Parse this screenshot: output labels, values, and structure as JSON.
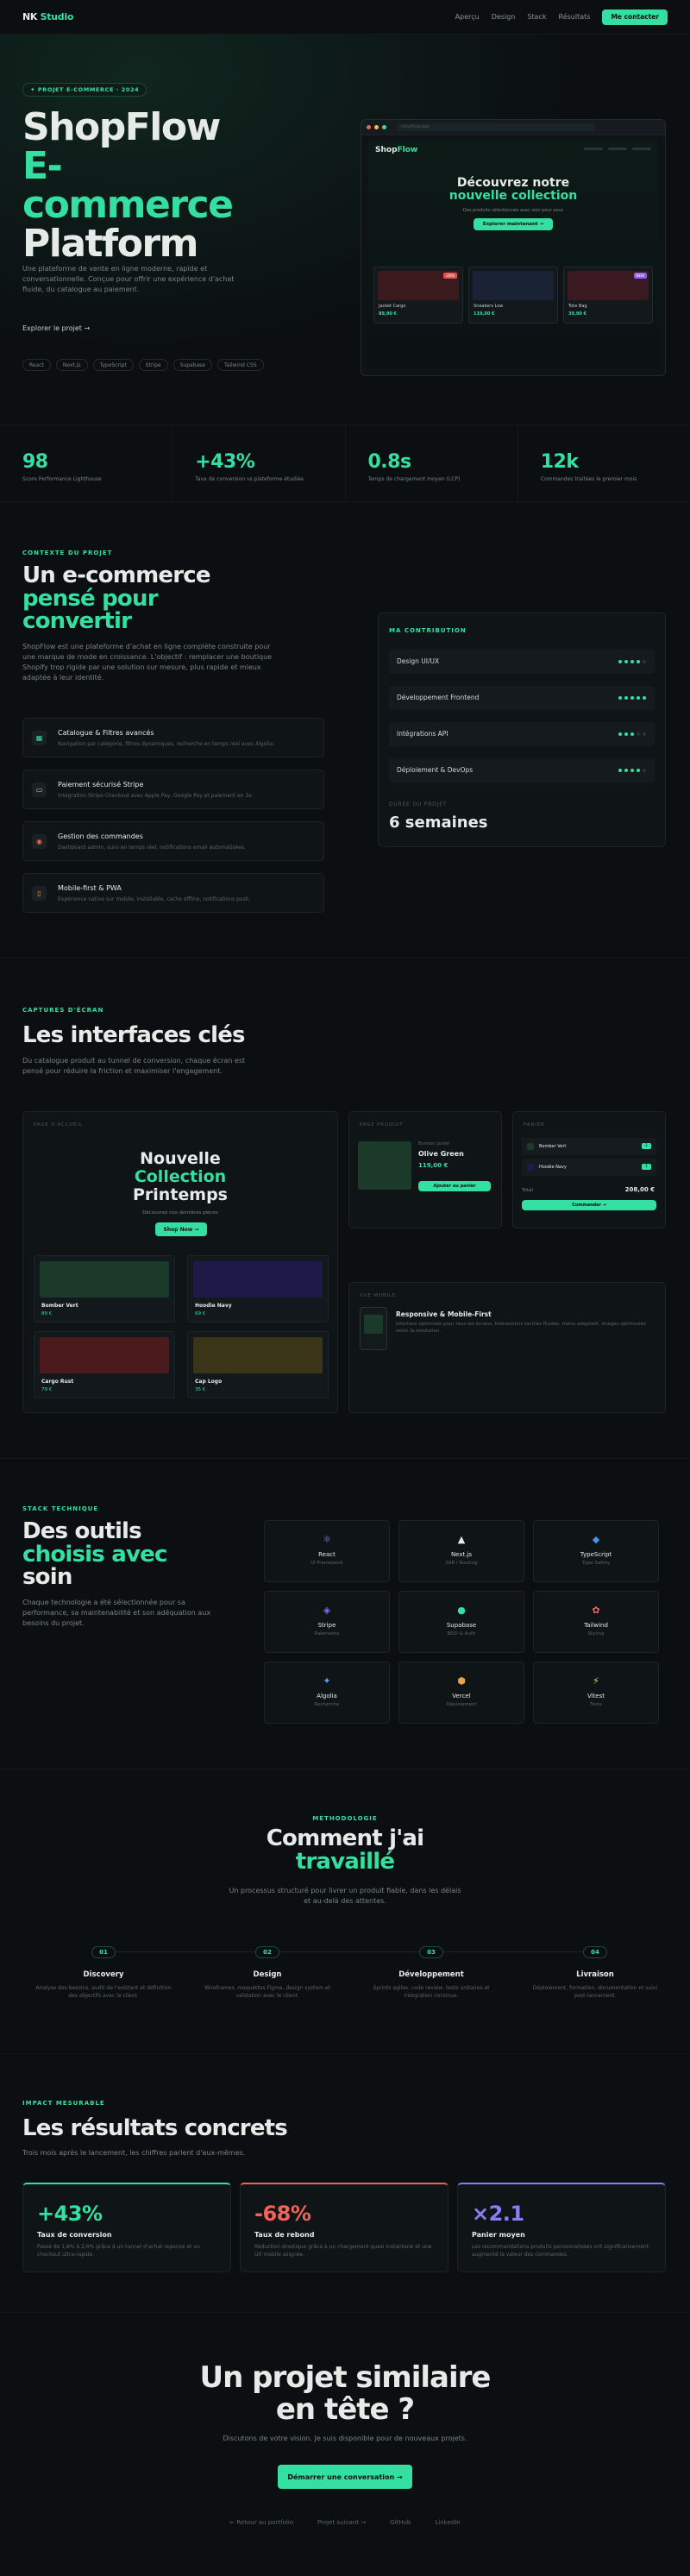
{
  "nav": {
    "logo_a": "NK",
    "logo_b": "Studio",
    "links": [
      "Aperçu",
      "Design",
      "Stack",
      "Résultats"
    ],
    "cta": "Me contacter"
  },
  "hero": {
    "pill": "✦ PROJET E-COMMERCE · 2024",
    "title_l1": "ShopFlow",
    "title_l2": "E-",
    "title_l3": "commerce",
    "title_l4": "Platform",
    "desc": "Une plateforme de vente en ligne moderne, rapide et conversationnelle. Conçue pour offrir une expérience d'achat fluide, du catalogue au paiement.",
    "explore": "Explorer le projet  →",
    "tags": [
      "React",
      "Next.js",
      "TypeScript",
      "Stripe",
      "Supabase",
      "Tailwind CSS"
    ]
  },
  "mockup": {
    "url": "shopflow.app",
    "logo_a": "Shop",
    "logo_b": "Flow",
    "h_l1": "Découvrez notre",
    "h_l2": "nouvelle collection",
    "sub": "Des produits sélectionnés avec soin pour vous",
    "btn": "Explorer maintenant →",
    "cards": [
      {
        "name": "Jacket Cargo",
        "price": "89,90 €",
        "badge": "-20%",
        "badge_color": "#e0524a",
        "img": "#3a1a1c"
      },
      {
        "name": "Sneakers Low",
        "price": "119,00 €",
        "badge": "",
        "badge_color": "",
        "img": "#1a2236"
      },
      {
        "name": "Tote Bag",
        "price": "39,90 €",
        "badge": "NEW",
        "badge_color": "#8a5cf0",
        "img": "#3a1a20"
      }
    ]
  },
  "stats": [
    {
      "value": "98",
      "label": "Score Performance Lighthouse"
    },
    {
      "value": "+43%",
      "label": "Taux de conversion vs plateforme étudiée"
    },
    {
      "value": "0.8s",
      "label": "Temps de chargement moyen (LCP)"
    },
    {
      "value": "12k",
      "label": "Commandes traitées le premier mois"
    }
  ],
  "context": {
    "eyebrow": "CONTEXTE DU PROJET",
    "title_l1": "Un e-commerce",
    "title_l2": "pensé pour",
    "title_l3": "convertir",
    "desc": "ShopFlow est une plateforme d'achat en ligne complète construite pour une marque de mode en croissance. L'objectif : remplacer une boutique Shopify trop rigide par une solution sur mesure, plus rapide et mieux adaptée à leur identité.",
    "features": [
      {
        "icon": "▦",
        "title": "Catalogue & Filtres avancés",
        "desc": "Navigation par catégorie, filtres dynamiques, recherche en temps réel avec Algolia."
      },
      {
        "icon": "▭",
        "title": "Paiement sécurisé Stripe",
        "desc": "Intégration Stripe Checkout avec Apple Pay, Google Pay et paiement en 3x."
      },
      {
        "icon": "◉",
        "title": "Gestion des commandes",
        "desc": "Dashboard admin, suivi en temps réel, notifications email automatisées."
      },
      {
        "icon": "▯",
        "title": "Mobile-first & PWA",
        "desc": "Expérience native sur mobile, installable, cache offline, notifications push."
      }
    ],
    "contrib_title": "MA CONTRIBUTION",
    "contrib": [
      {
        "name": "Design UI/UX",
        "level": 4
      },
      {
        "name": "Développement Frontend",
        "level": 5
      },
      {
        "name": "Intégrations API",
        "level": 3
      },
      {
        "name": "Déploiement & DevOps",
        "level": 4
      }
    ],
    "duration_label": "DURÉE DU PROJET",
    "duration": "6 semaines"
  },
  "screens": {
    "eyebrow": "CAPTURES D'ÉCRAN",
    "title": "Les interfaces clés",
    "desc": "Du catalogue produit au tunnel de conversion, chaque écran est pensé pour réduire la friction et maximiser l'engagement.",
    "home": {
      "label": "PAGE D'ACCUEIL",
      "h_l1": "Nouvelle",
      "h_l2": "Collection",
      "h_l3": "Printemps",
      "sub": "Découvrez nos dernières pièces",
      "btn": "Shop Now →",
      "items": [
        {
          "name": "Bomber Vert",
          "price": "89 €",
          "img": "#1c3a2a"
        },
        {
          "name": "Hoodie Navy",
          "price": "69 €",
          "img": "#1e1a48"
        },
        {
          "name": "Cargo Rust",
          "price": "79 €",
          "img": "#4a1a1c"
        },
        {
          "name": "Cap Logo",
          "price": "35 €",
          "img": "#3a3418"
        }
      ]
    },
    "product": {
      "label": "PAGE PRODUIT",
      "kicker": "Bomber Jacket",
      "name": "Olive Green",
      "price": "119,00 €",
      "btn": "Ajouter au panier"
    },
    "cart": {
      "label": "PANIER",
      "items": [
        {
          "name": "Bomber Vert",
          "qty": "1"
        },
        {
          "name": "Hoodie Navy",
          "qty": "1"
        }
      ],
      "total_label": "Total",
      "total": "208,00 €",
      "btn": "Commander →"
    },
    "mobile": {
      "label": "VUE MOBILE",
      "title": "Responsive & Mobile-First",
      "desc": "Interface optimisée pour tous les écrans. Interactions tactiles fluides, menu adaptatif, images optimisées selon la résolution."
    }
  },
  "stack": {
    "eyebrow": "STACK TECHNIQUE",
    "title_l1": "Des outils",
    "title_l2": "choisis avec",
    "title_l3": "soin",
    "desc": "Chaque technologie a été sélectionnée pour sa performance, sa maintenabilité et son adéquation aux besoins du projet.",
    "items": [
      {
        "icon": "⚛",
        "name": "React",
        "role": "UI Framework",
        "color": "#7f8cf5"
      },
      {
        "icon": "▲",
        "name": "Next.js",
        "role": "SSR / Routing",
        "color": "#e6ebe8"
      },
      {
        "icon": "◆",
        "name": "TypeScript",
        "role": "Type Safety",
        "color": "#4a8ff0"
      },
      {
        "icon": "◈",
        "name": "Stripe",
        "role": "Paiements",
        "color": "#7f6df5"
      },
      {
        "icon": "●",
        "name": "Supabase",
        "role": "BDD & Auth",
        "color": "#34e0a1"
      },
      {
        "icon": "✿",
        "name": "Tailwind",
        "role": "Styling",
        "color": "#f06a6a"
      },
      {
        "icon": "✦",
        "name": "Algolia",
        "role": "Recherche",
        "color": "#5aa0f0"
      },
      {
        "icon": "⬢",
        "name": "Vercel",
        "role": "Déploiement",
        "color": "#f0a04a"
      },
      {
        "icon": "⚡",
        "name": "Vitest",
        "role": "Tests",
        "color": "#c4e04a"
      }
    ]
  },
  "method": {
    "eyebrow": "MÉTHODOLOGIE",
    "title_l1": "Comment j'ai",
    "title_l2": "travaillé",
    "desc_l1": "Un processus structuré pour livrer un produit fiable, dans les délais",
    "desc_l2": "et au-delà des attentes.",
    "steps": [
      {
        "num": "01",
        "title": "Discovery",
        "desc": "Analyse des besoins, audit de l'existant et définition des objectifs avec le client."
      },
      {
        "num": "02",
        "title": "Design",
        "desc": "Wireframes, maquettes Figma, design system et validation avec le client."
      },
      {
        "num": "03",
        "title": "Développement",
        "desc": "Sprints agiles, code review, tests unitaires et intégration continue."
      },
      {
        "num": "04",
        "title": "Livraison",
        "desc": "Déploiement, formation, documentation et suivi post-lancement."
      }
    ]
  },
  "impact": {
    "eyebrow": "IMPACT MESURABLE",
    "title": "Les résultats concrets",
    "desc": "Trois mois après le lancement, les chiffres parlent d'eux-mêmes.",
    "cards": [
      {
        "value": "+43%",
        "label": "Taux de conversion",
        "desc": "Passé de 1,8% à 2,6% grâce à un tunnel d'achat repensé et un checkout ultra-rapide.",
        "color": "#34e0a1"
      },
      {
        "value": "-68%",
        "label": "Taux de rebond",
        "desc": "Réduction drastique grâce à un chargement quasi instantané et une UX mobile soignée.",
        "color": "#f0625a"
      },
      {
        "value": "×2.1",
        "label": "Panier moyen",
        "desc": "Les recommandations produits personnalisées ont significativement augmenté la valeur des commandes.",
        "color": "#8a7cf5"
      }
    ]
  },
  "cta": {
    "title_l1": "Un projet similaire",
    "title_l2": "en tête ?",
    "sub": "Discutons de votre vision. Je suis disponible pour de nouveaux projets.",
    "btn": "Démarrer une conversation  →",
    "links": [
      "← Retour au portfolio",
      "Projet suivant →",
      "GitHub",
      "LinkedIn"
    ]
  }
}
